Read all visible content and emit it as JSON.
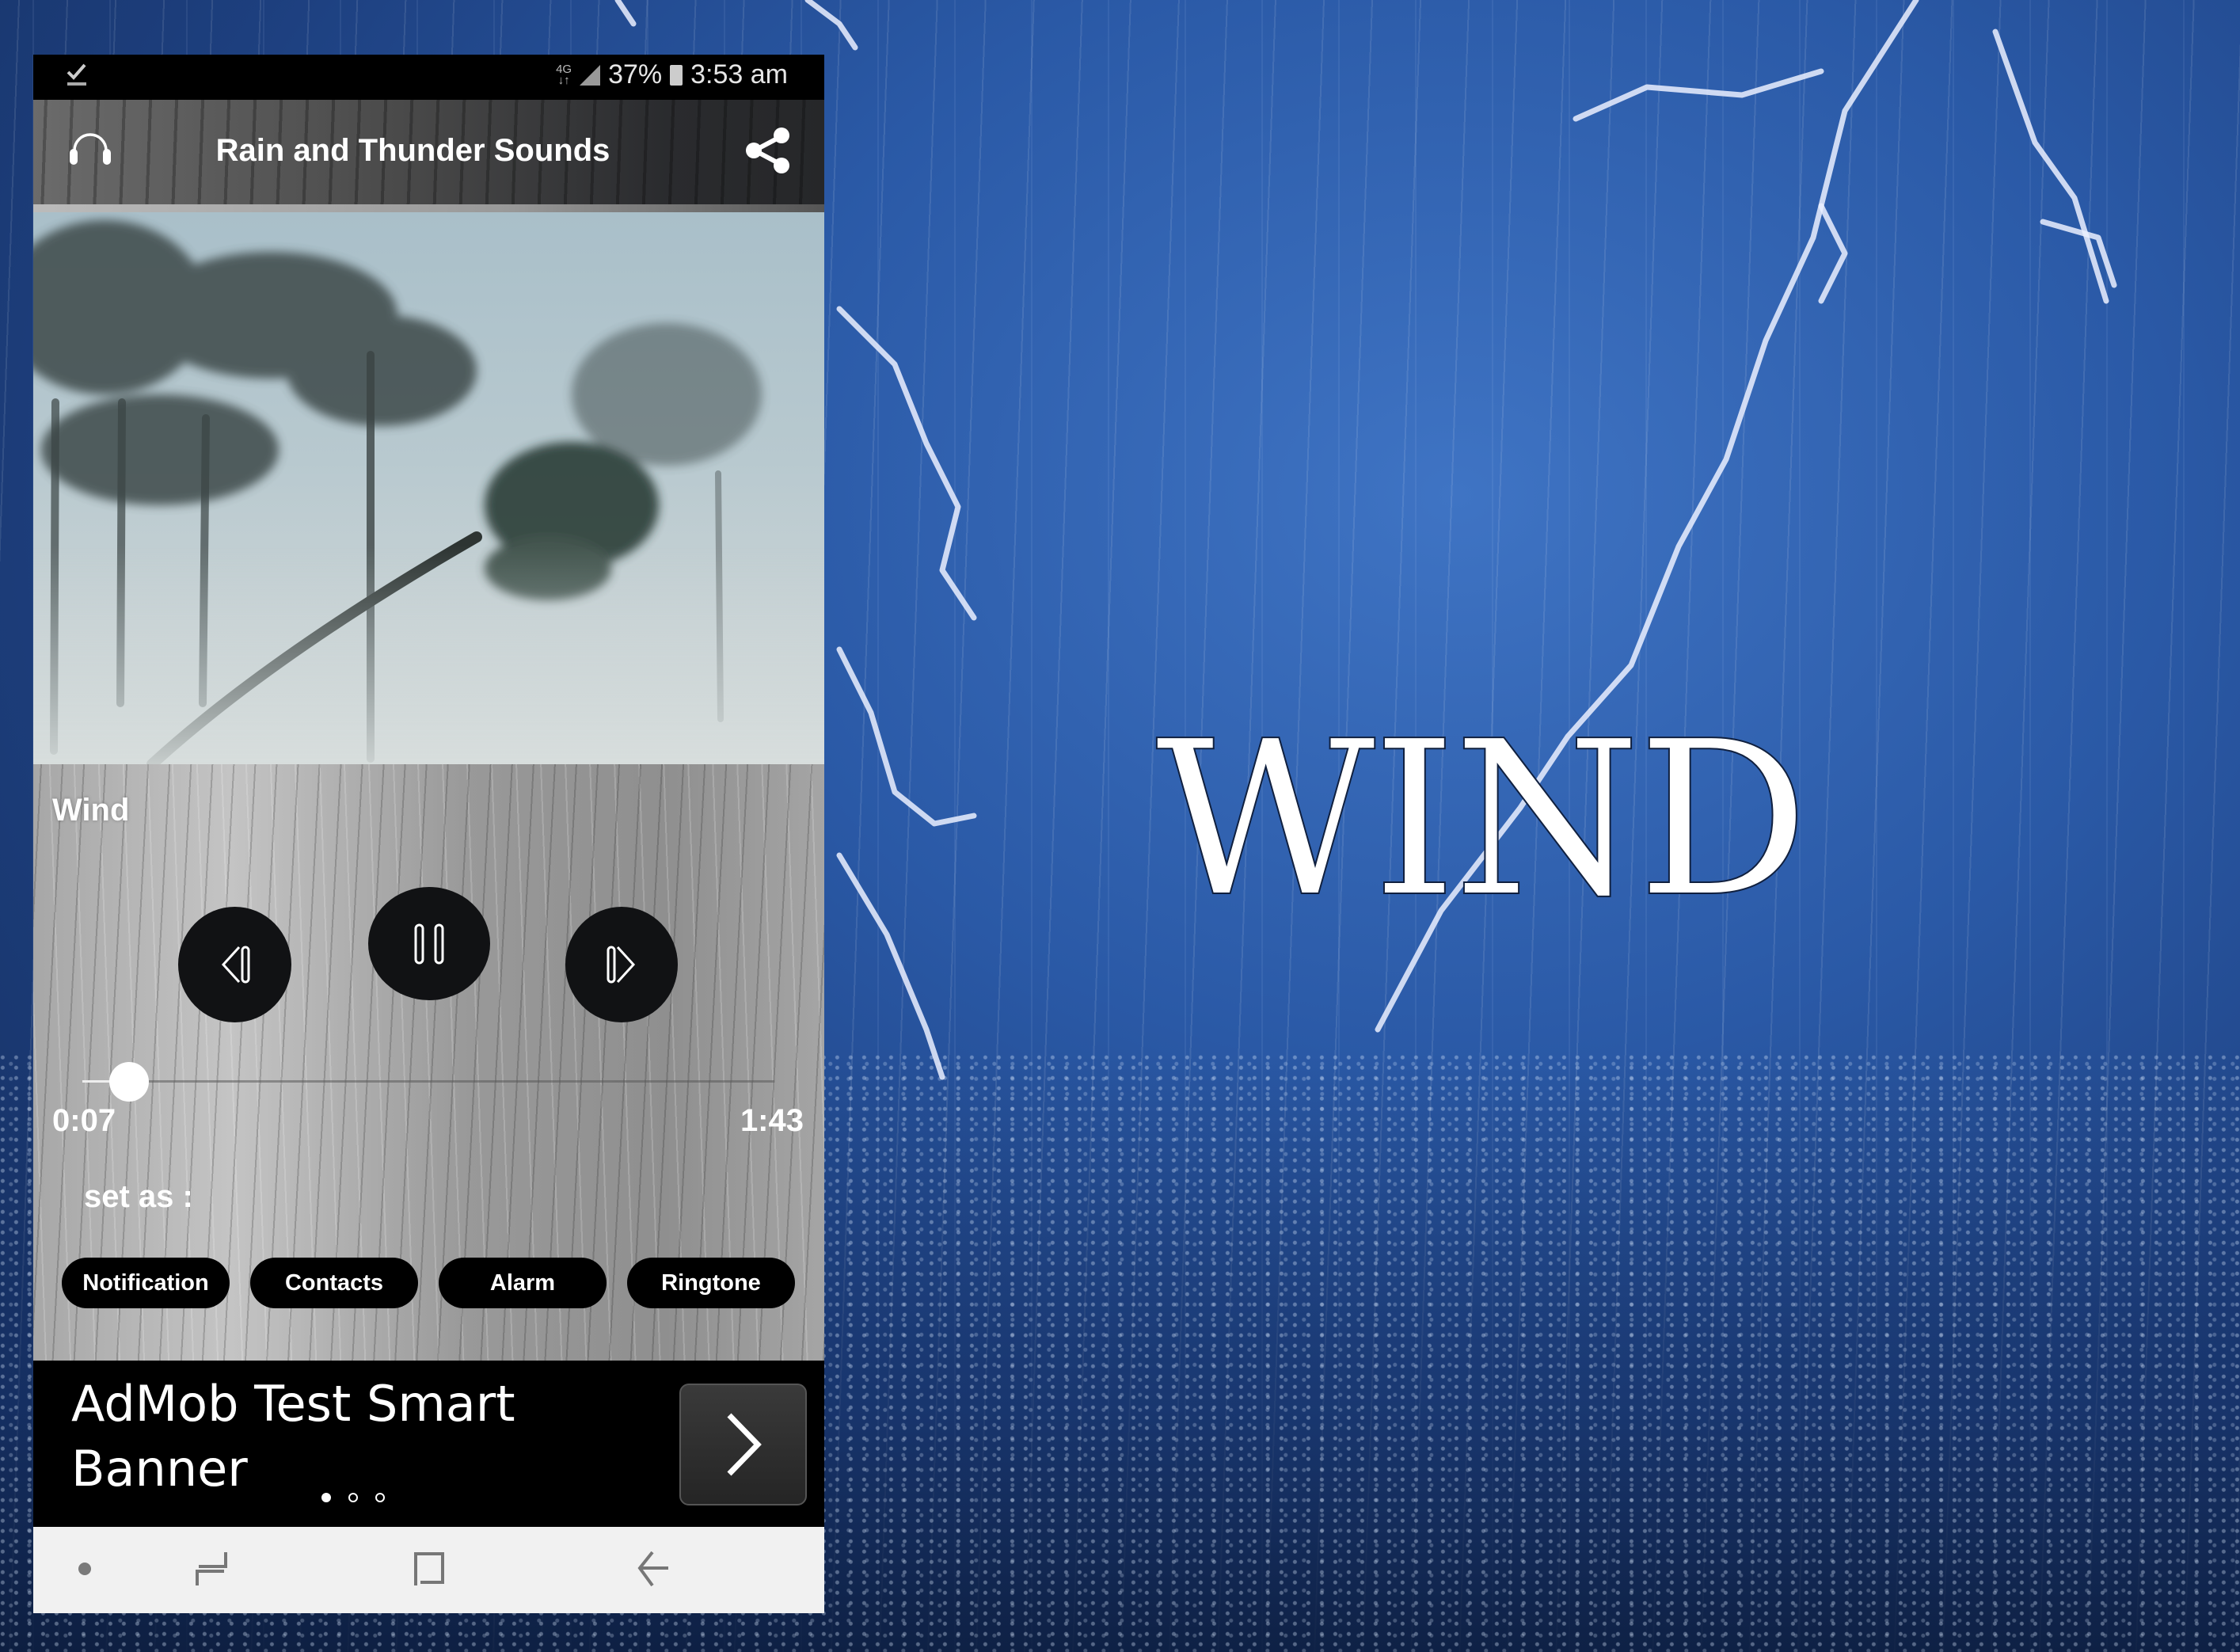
{
  "status_bar": {
    "notification_icon": "download-done-icon",
    "network": "4G",
    "battery_percent": "37%",
    "time": "3:53 am"
  },
  "app_bar": {
    "title": "Rain and Thunder Sounds",
    "left_icon": "headphones-icon",
    "right_icon": "share-icon"
  },
  "player": {
    "track_name": "Wind",
    "current_time": "0:07",
    "total_time": "1:43",
    "progress_fraction": 0.068,
    "state": "playing",
    "controls": [
      "previous",
      "pause",
      "next"
    ]
  },
  "set_as": {
    "label": "set as :",
    "options": [
      "Notification",
      "Contacts",
      "Alarm",
      "Ringtone"
    ]
  },
  "ad": {
    "text": "AdMob Test Smart Banner",
    "page_count": 3,
    "active_page": 0
  },
  "nav_bar": {
    "items": [
      "dot",
      "recents",
      "home",
      "back"
    ]
  },
  "promo": {
    "headline": "WIND"
  }
}
